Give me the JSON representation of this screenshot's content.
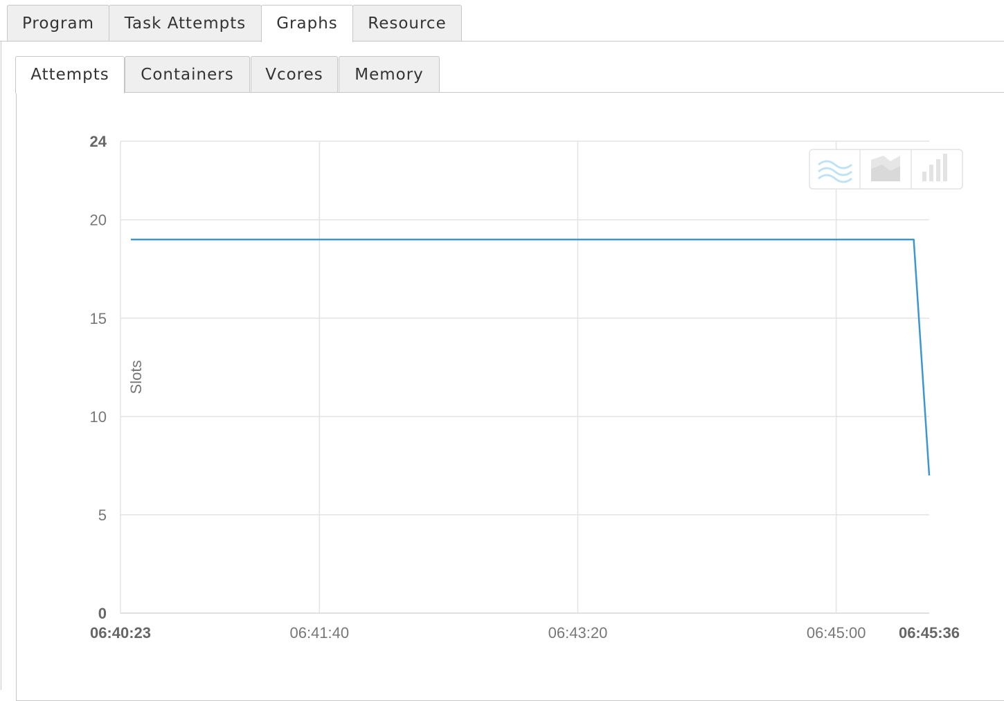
{
  "top_tabs": [
    "Program",
    "Task Attempts",
    "Graphs",
    "Resource"
  ],
  "top_active": "Graphs",
  "sub_tabs": [
    "Attempts",
    "Containers",
    "Vcores",
    "Memory"
  ],
  "sub_active": "Attempts",
  "chart_toolbar": [
    "line-chart-icon",
    "area-chart-icon",
    "bar-chart-icon"
  ],
  "colors": {
    "series": "#3a97d4",
    "grid": "#e3e3e3",
    "axis_text": "#777777"
  },
  "chart_data": {
    "type": "line",
    "ylabel": "Slots",
    "xlabel": "",
    "ylim": [
      0,
      24
    ],
    "y_ticks": [
      {
        "value": 0,
        "label": "0",
        "bold": true
      },
      {
        "value": 5,
        "label": "5",
        "bold": false
      },
      {
        "value": 10,
        "label": "10",
        "bold": false
      },
      {
        "value": 15,
        "label": "15",
        "bold": false
      },
      {
        "value": 20,
        "label": "20",
        "bold": false
      },
      {
        "value": 24,
        "label": "24",
        "bold": true
      }
    ],
    "x_ticks": [
      {
        "value": "06:40:23",
        "bold": true
      },
      {
        "value": "06:41:40",
        "bold": false
      },
      {
        "value": "06:43:20",
        "bold": false
      },
      {
        "value": "06:45:00",
        "bold": false
      },
      {
        "value": "06:45:36",
        "bold": true
      }
    ],
    "xlim": [
      "06:40:23",
      "06:45:36"
    ],
    "grid": true,
    "series": [
      {
        "x": [
          "06:40:27",
          "06:45:30",
          "06:45:36"
        ],
        "y": [
          19,
          19,
          7
        ]
      }
    ]
  }
}
